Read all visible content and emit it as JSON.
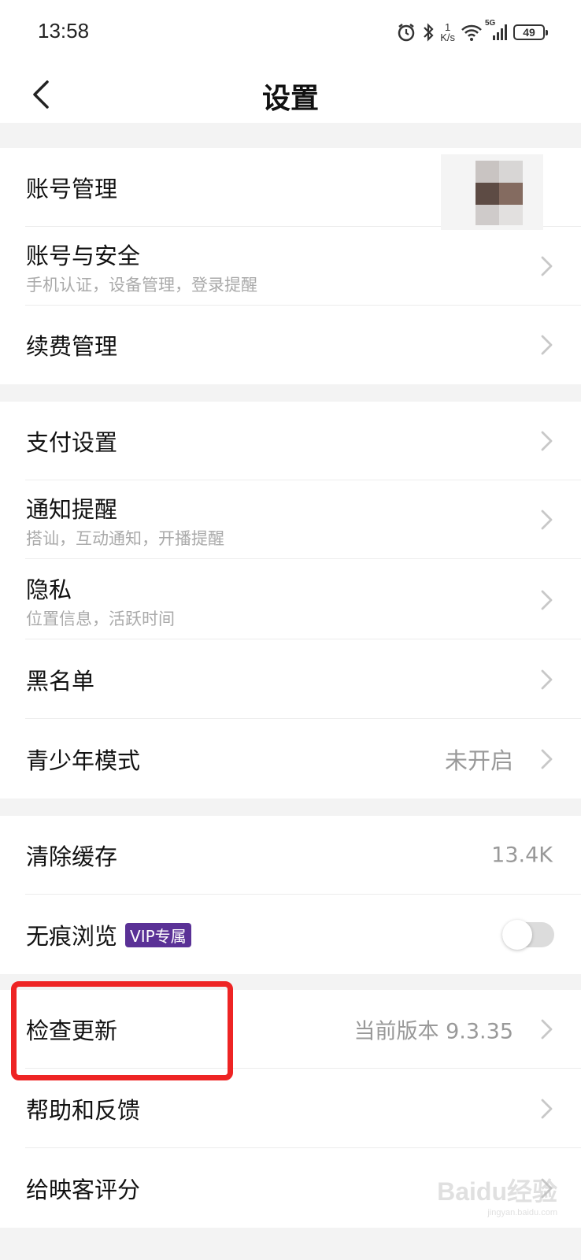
{
  "status_bar": {
    "time": "13:58",
    "net_speed_value": "1",
    "net_speed_unit": "K/s",
    "signal_type": "5G",
    "battery_level": "49",
    "icons": [
      "alarm-icon",
      "bluetooth-icon",
      "wifi-icon",
      "cellular-signal-icon",
      "battery-icon"
    ]
  },
  "header": {
    "title": "设置",
    "back_icon": "chevron-left-icon"
  },
  "sections": [
    {
      "items": [
        {
          "label": "账号管理"
        },
        {
          "label": "账号与安全",
          "subtitle": "手机认证，设备管理，登录提醒"
        },
        {
          "label": "续费管理"
        }
      ]
    },
    {
      "items": [
        {
          "label": "支付设置"
        },
        {
          "label": "通知提醒",
          "subtitle": "搭讪，互动通知，开播提醒"
        },
        {
          "label": "隐私",
          "subtitle": "位置信息，活跃时间"
        },
        {
          "label": "黑名单"
        },
        {
          "label": "青少年模式",
          "value": "未开启"
        }
      ]
    },
    {
      "items": [
        {
          "label": "清除缓存",
          "value": "13.4K"
        },
        {
          "label": "无痕浏览",
          "badge": "VIP专属",
          "toggle_on": false
        }
      ]
    },
    {
      "items": [
        {
          "label": "检查更新",
          "value": "当前版本 9.3.35"
        },
        {
          "label": "帮助和反馈"
        },
        {
          "label": "给映客评分"
        }
      ]
    }
  ],
  "watermark": {
    "text": "Baidu经验",
    "url_text": "jingyan.baidu.com"
  },
  "colors": {
    "background": "#ffffff",
    "section_gap": "#f3f3f3",
    "vip_badge": "#5a3196",
    "highlight": "#ee2424",
    "secondary_text": "#999999"
  }
}
